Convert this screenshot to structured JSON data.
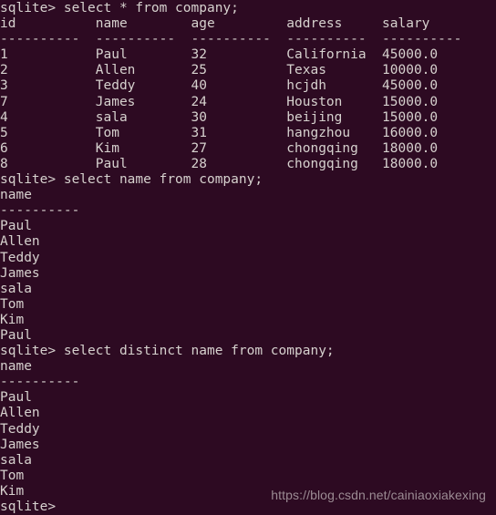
{
  "terminal": {
    "shell_prompt": "sqlite>",
    "background_color": "#2d0a22",
    "text_color": "#d6d1ce",
    "columns": 54,
    "rows": 33,
    "watermark": "https://blog.csdn.net/cainiaoxiakexing",
    "watermark_color": "#9b8b93"
  },
  "queries": [
    {
      "prompt": "sqlite>",
      "command": "select * from company;",
      "headers": [
        "id",
        "name",
        "age",
        "address",
        "salary"
      ],
      "separator": "----------",
      "rows": [
        [
          "1",
          "Paul",
          "32",
          "California",
          "45000.0"
        ],
        [
          "2",
          "Allen",
          "25",
          "Texas",
          "10000.0"
        ],
        [
          "3",
          "Teddy",
          "40",
          "hcjdh",
          "45000.0"
        ],
        [
          "7",
          "James",
          "24",
          "Houston",
          "15000.0"
        ],
        [
          "4",
          "sala",
          "30",
          "beijing",
          "15000.0"
        ],
        [
          "5",
          "Tom",
          "31",
          "hangzhou",
          "16000.0"
        ],
        [
          "6",
          "Kim",
          "27",
          "chongqing",
          "18000.0"
        ],
        [
          "8",
          "Paul",
          "28",
          "chongqing",
          "18000.0"
        ]
      ]
    },
    {
      "prompt": "sqlite>",
      "command": "select name from company;",
      "headers": [
        "name"
      ],
      "separator": "----------",
      "rows": [
        [
          "Paul"
        ],
        [
          "Allen"
        ],
        [
          "Teddy"
        ],
        [
          "James"
        ],
        [
          "sala"
        ],
        [
          "Tom"
        ],
        [
          "Kim"
        ],
        [
          "Paul"
        ]
      ]
    },
    {
      "prompt": "sqlite>",
      "command": "select distinct name from company;",
      "headers": [
        "name"
      ],
      "separator": "----------",
      "rows": [
        [
          "Paul"
        ],
        [
          "Allen"
        ],
        [
          "Teddy"
        ],
        [
          "James"
        ],
        [
          "sala"
        ],
        [
          "Tom"
        ],
        [
          "Kim"
        ]
      ]
    }
  ],
  "lines": [
    "sqlite> select * from company;",
    "id          name        age         address     salary",
    "----------  ----------  ----------  ----------  ----------",
    "1           Paul        32          California  45000.0",
    "2           Allen       25          Texas       10000.0",
    "3           Teddy       40          hcjdh       45000.0",
    "7           James       24          Houston     15000.0",
    "4           sala        30          beijing     15000.0",
    "5           Tom         31          hangzhou    16000.0",
    "6           Kim         27          chongqing   18000.0",
    "8           Paul        28          chongqing   18000.0",
    "sqlite> select name from company;",
    "name",
    "----------",
    "Paul",
    "Allen",
    "Teddy",
    "James",
    "sala",
    "Tom",
    "Kim",
    "Paul",
    "sqlite> select distinct name from company;",
    "name",
    "----------",
    "Paul",
    "Allen",
    "Teddy",
    "James",
    "sala",
    "Tom",
    "Kim",
    "sqlite>"
  ]
}
